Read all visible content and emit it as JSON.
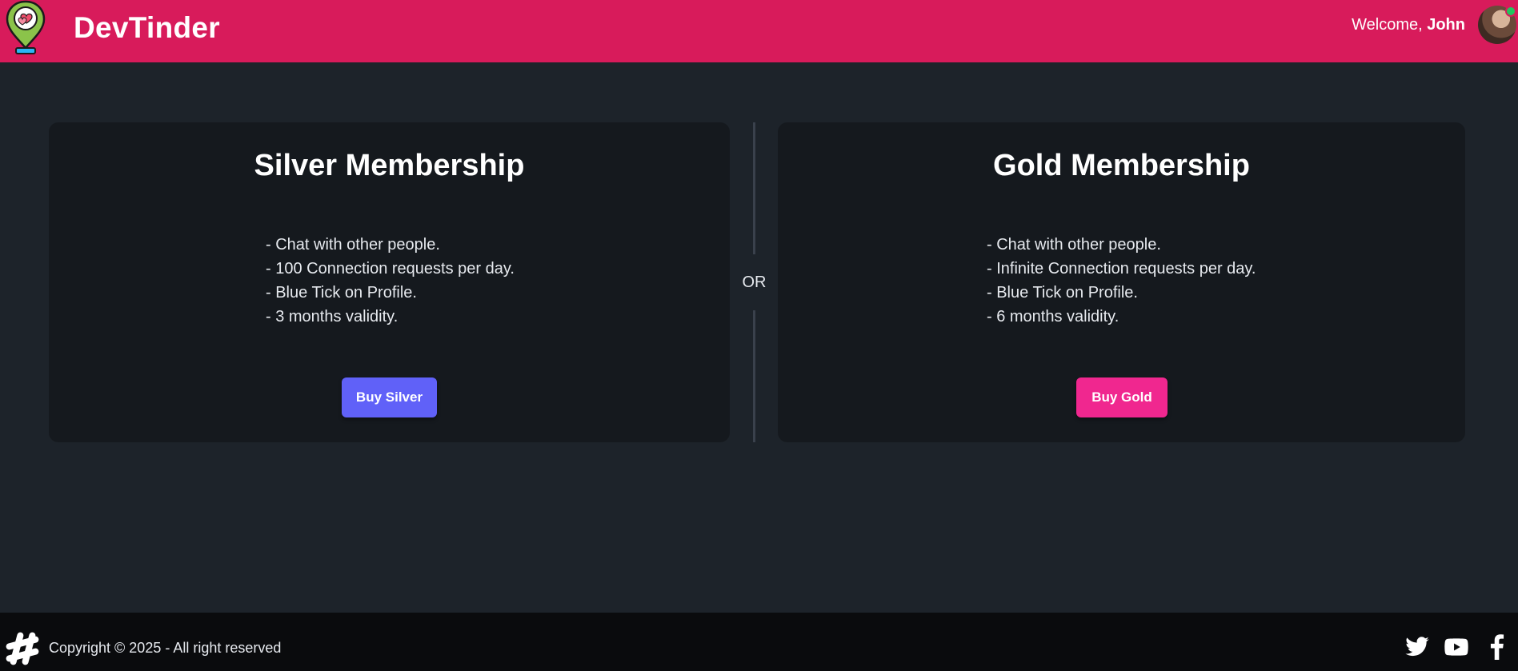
{
  "navbar": {
    "brand": "DevTinder",
    "welcome_prefix": "Welcome, ",
    "user_name": "John",
    "accent_color": "#d81b5b"
  },
  "plans": [
    {
      "title": "Silver Membership",
      "features": [
        "- Chat with other people.",
        "- 100 Connection requests per day.",
        "- Blue Tick on Profile.",
        "- 3 months validity."
      ],
      "button_label": "Buy Silver",
      "button_color": "#6061f8"
    },
    {
      "title": "Gold Membership",
      "features": [
        "- Chat with other people.",
        "- Infinite Connection requests per day.",
        "- Blue Tick on Profile.",
        "- 6 months validity."
      ],
      "button_label": "Buy Gold",
      "button_color": "#f0278f"
    }
  ],
  "divider_text": "OR",
  "footer": {
    "copyright": "Copyright © 2025 - All right reserved",
    "social_icons": [
      "twitter-icon",
      "youtube-icon",
      "facebook-icon"
    ]
  }
}
